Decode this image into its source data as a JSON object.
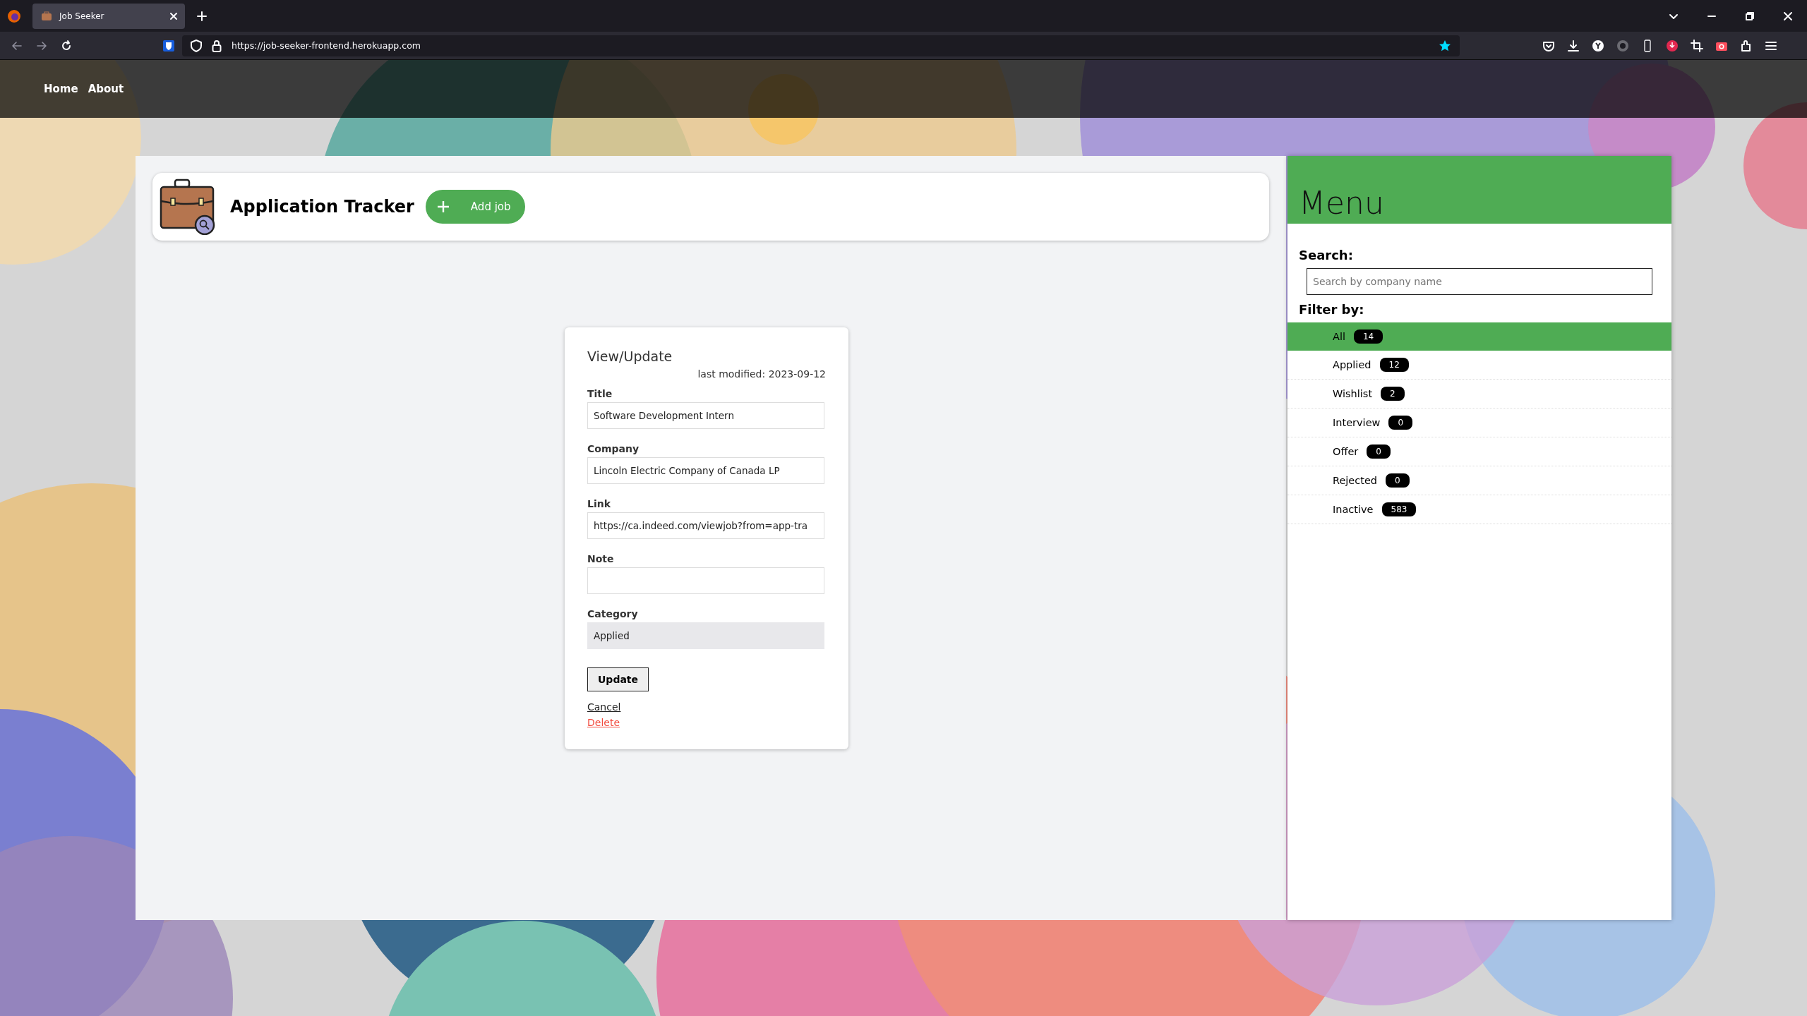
{
  "browser": {
    "tabs": [
      {
        "title": "Job Seeker",
        "selected": true
      }
    ],
    "url": "https://job-seeker-frontend.herokuapp.com"
  },
  "nav": [
    {
      "label": "Home"
    },
    {
      "label": "About"
    }
  ],
  "header": {
    "title": "Application Tracker",
    "add_button": "Add job"
  },
  "form": {
    "heading": "View/Update",
    "last_modified": "last modified: 2023-09-12",
    "fields": [
      {
        "label": "Title",
        "value": "Software Development Intern",
        "kind": "text"
      },
      {
        "label": "Company",
        "value": "Lincoln Electric Company of Canada LP",
        "kind": "text"
      },
      {
        "label": "Link",
        "value": "https://ca.indeed.com/viewjob?from=app-tra",
        "kind": "text"
      },
      {
        "label": "Note",
        "kind": "text"
      },
      {
        "label": "Category",
        "value": "Applied",
        "kind": "select"
      }
    ],
    "submit": "Update",
    "links": [
      {
        "label": "Cancel",
        "kind": "plain"
      },
      {
        "label": "Delete",
        "kind": "danger"
      }
    ]
  },
  "menu": {
    "title": "Menu",
    "search_label": "Search:",
    "search": {
      "placeholder": "Search by company name"
    },
    "filter_label": "Filter by:",
    "filters": [
      {
        "label": "All",
        "count": "14",
        "selected": true
      },
      {
        "label": "Applied",
        "count": "12",
        "selected": false
      },
      {
        "label": "Wishlist",
        "count": "2",
        "selected": false
      },
      {
        "label": "Interview",
        "count": "0",
        "selected": false
      },
      {
        "label": "Offer",
        "count": "0",
        "selected": false
      },
      {
        "label": "Rejected",
        "count": "0",
        "selected": false
      },
      {
        "label": "Inactive",
        "count": "583",
        "selected": false
      }
    ]
  }
}
